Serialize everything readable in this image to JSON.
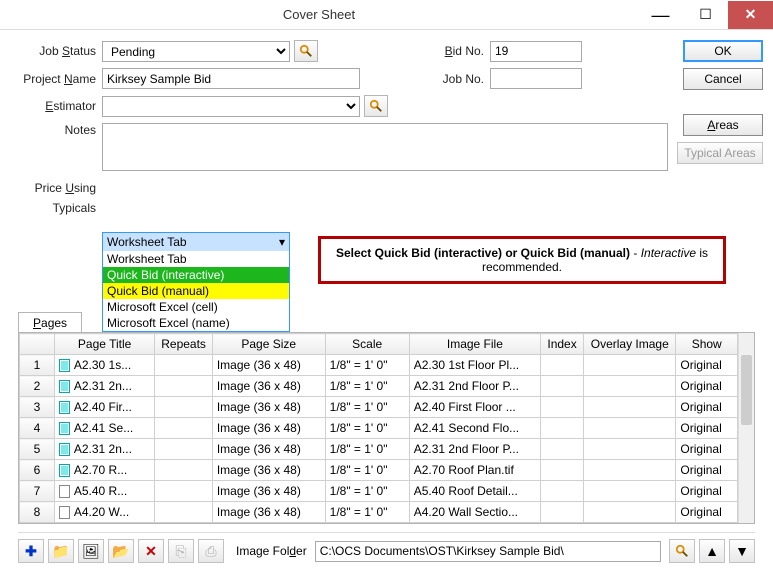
{
  "window": {
    "title": "Cover Sheet"
  },
  "labels": {
    "jobStatus": "Job Status",
    "projectName": "Project Name",
    "estimator": "Estimator",
    "notes": "Notes",
    "bidNo": "Bid No.",
    "jobNo": "Job No.",
    "priceUsing": "Price Using",
    "typicals": "Typicals",
    "pagesTab": "Pages",
    "imageFolder": "Image Folder"
  },
  "buttons": {
    "ok": "OK",
    "cancel": "Cancel",
    "areas": "Areas",
    "typicalAreas": "Typical Areas"
  },
  "fields": {
    "jobStatus": "Pending",
    "projectName": "Kirksey Sample Bid",
    "estimator": "",
    "notes": "",
    "bidNo": "19",
    "jobNo": "",
    "imageFolder": "C:\\OCS Documents\\OST\\Kirksey Sample Bid\\"
  },
  "priceUsing": {
    "selected": "Worksheet Tab",
    "options": [
      "Worksheet Tab",
      "Quick Bid (interactive)",
      "Quick Bid (manual)",
      "Microsoft Excel (cell)",
      "Microsoft Excel (name)"
    ]
  },
  "callout": {
    "prefix": "Select Quick Bid (interactive) or Quick Bid (manual)",
    "mid": " - ",
    "italic": "Interactive",
    "suffix": " is recommended."
  },
  "columns": [
    "",
    "Page Title",
    "Repeats",
    "Page Size",
    "Scale",
    "Image File",
    "Index",
    "Overlay Image",
    "Show"
  ],
  "rows": [
    {
      "n": "1",
      "icon": "cyan",
      "title": "A2.30 1s...",
      "repeats": "",
      "size": "Image (36 x 48)",
      "scale": "1/8\" = 1' 0\"",
      "file": "A2.30 1st Floor Pl...",
      "idx": "",
      "overlay": "",
      "show": "Original"
    },
    {
      "n": "2",
      "icon": "cyan",
      "title": "A2.31 2n...",
      "repeats": "",
      "size": "Image (36 x 48)",
      "scale": "1/8\" = 1' 0\"",
      "file": "A2.31 2nd Floor P...",
      "idx": "",
      "overlay": "",
      "show": "Original"
    },
    {
      "n": "3",
      "icon": "cyan",
      "title": "A2.40 Fir...",
      "repeats": "",
      "size": "Image (36 x 48)",
      "scale": "1/8\" = 1' 0\"",
      "file": "A2.40 First Floor ...",
      "idx": "",
      "overlay": "",
      "show": "Original"
    },
    {
      "n": "4",
      "icon": "cyan",
      "title": "A2.41 Se...",
      "repeats": "",
      "size": "Image (36 x 48)",
      "scale": "1/8\" = 1' 0\"",
      "file": "A2.41 Second Flo...",
      "idx": "",
      "overlay": "",
      "show": "Original"
    },
    {
      "n": "5",
      "icon": "cyan",
      "title": "A2.31 2n...",
      "repeats": "",
      "size": "Image (36 x 48)",
      "scale": "1/8\" = 1' 0\"",
      "file": "A2.31 2nd Floor P...",
      "idx": "",
      "overlay": "",
      "show": "Original"
    },
    {
      "n": "6",
      "icon": "cyan",
      "title": "A2.70 R...",
      "repeats": "",
      "size": "Image (36 x 48)",
      "scale": "1/8\" = 1' 0\"",
      "file": "A2.70 Roof Plan.tif",
      "idx": "",
      "overlay": "",
      "show": "Original"
    },
    {
      "n": "7",
      "icon": "plain",
      "title": "A5.40 R...",
      "repeats": "",
      "size": "Image (36 x 48)",
      "scale": "1/8\" = 1' 0\"",
      "file": "A5.40 Roof Detail...",
      "idx": "",
      "overlay": "",
      "show": "Original"
    },
    {
      "n": "8",
      "icon": "plain",
      "title": "A4.20 W...",
      "repeats": "",
      "size": "Image (36 x 48)",
      "scale": "1/8\" = 1' 0\"",
      "file": "A4.20 Wall Sectio...",
      "idx": "",
      "overlay": "",
      "show": "Original"
    }
  ]
}
